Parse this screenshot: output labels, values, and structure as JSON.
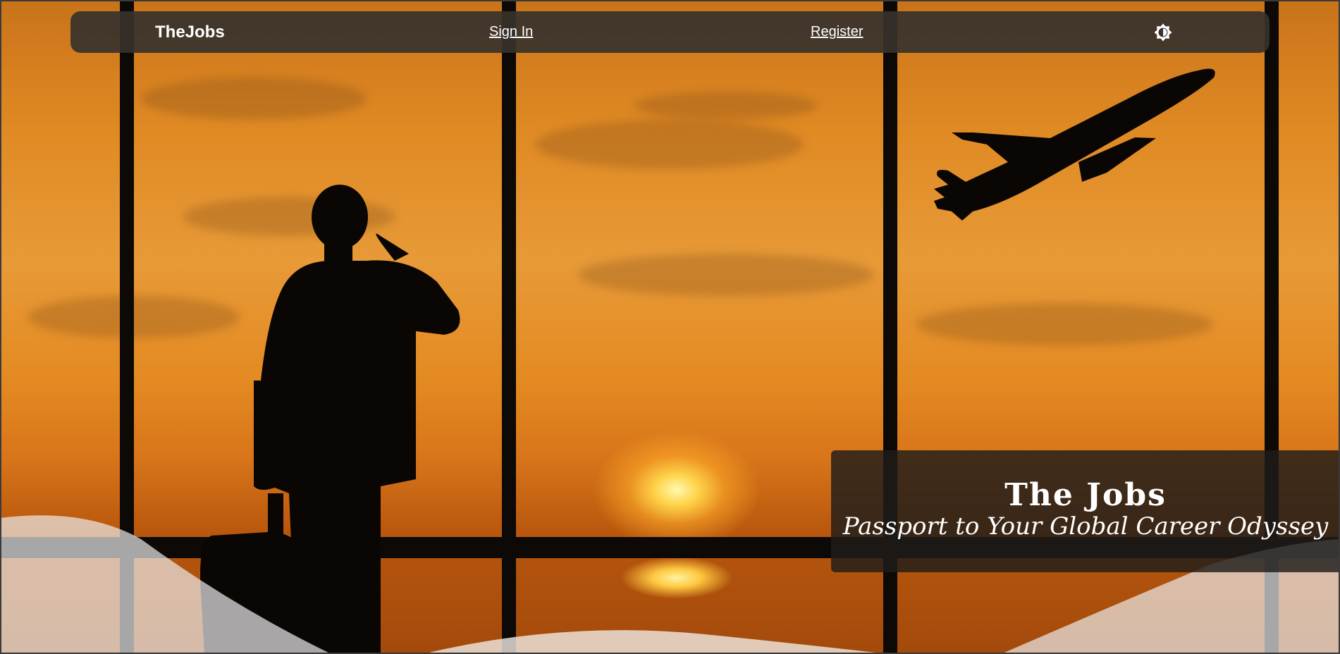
{
  "navbar": {
    "brand": "TheJobs",
    "sign_in": "Sign In",
    "register": "Register",
    "theme_toggle_icon": "brightness-icon"
  },
  "hero": {
    "title": "The Jobs",
    "subtitle": "Passport to Your Global Career Odyssey"
  },
  "colors": {
    "navbar_bg": "#37322d",
    "tagline_bg": "#1e1c1a",
    "sky_orange": "#e08a24",
    "text": "#ffffff"
  }
}
